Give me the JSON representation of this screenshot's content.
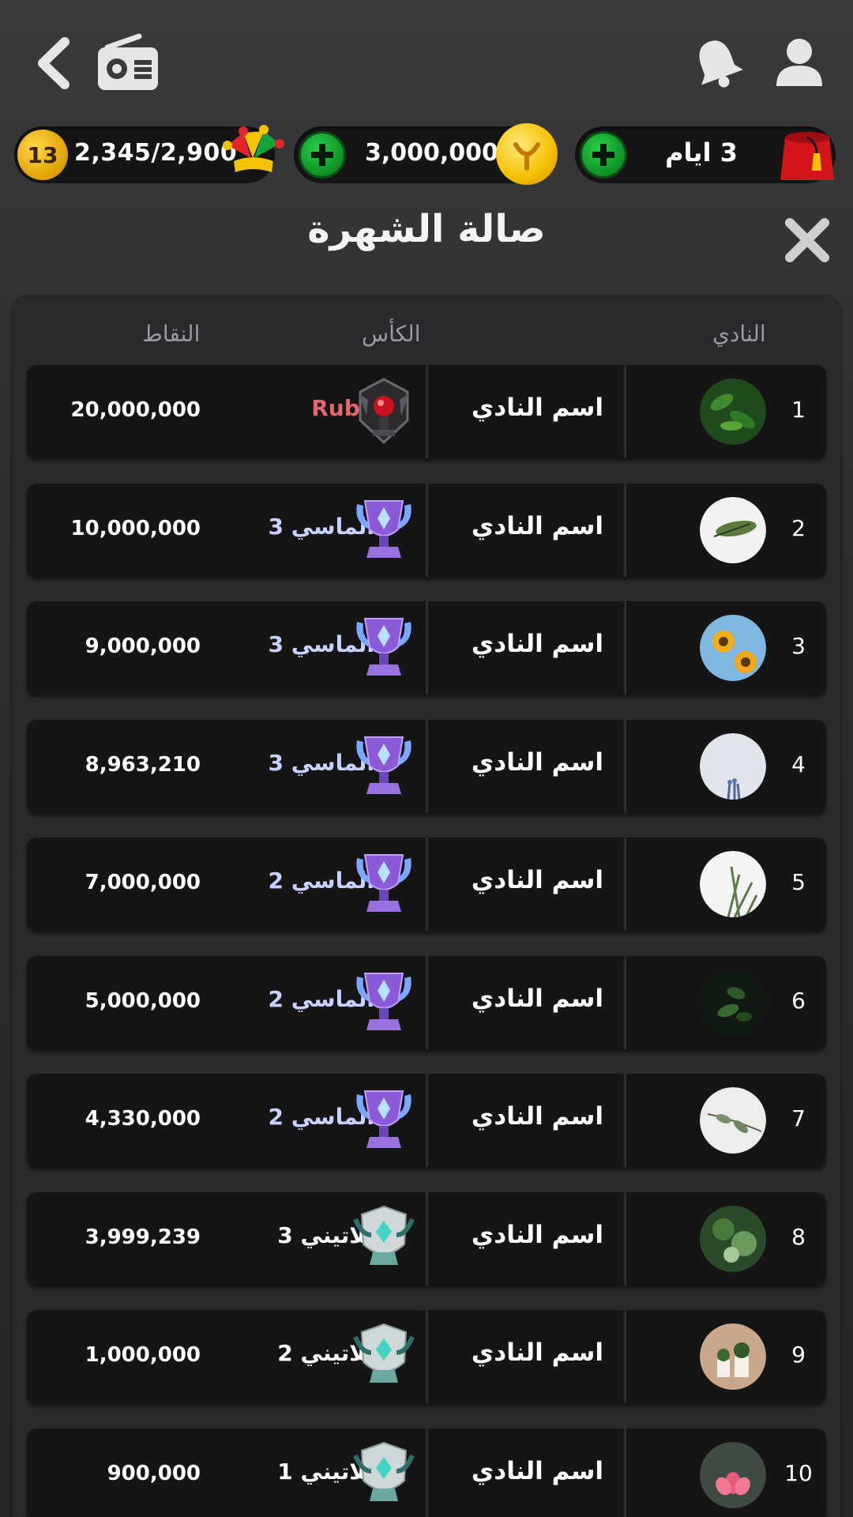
{
  "header": {
    "level": "13",
    "xp": "2,345/2,900",
    "coins": "3,000,000",
    "vip": "3 ايام",
    "title": "صالة الشهرة"
  },
  "table": {
    "col_points": "النقاط",
    "col_cup": "الكأس",
    "col_club": "النادي",
    "rows": [
      {
        "rank": "1",
        "club": "اسم النادي",
        "cup": "Ruby",
        "cup_tier": "ruby",
        "points": "20,000,000",
        "avatar": "green-leaves"
      },
      {
        "rank": "2",
        "club": "اسم النادي",
        "cup": "الماسي 3",
        "cup_tier": "diamond",
        "points": "10,000,000",
        "avatar": "white-leaf"
      },
      {
        "rank": "3",
        "club": "اسم النادي",
        "cup": "الماسي 3",
        "cup_tier": "diamond",
        "points": "9,000,000",
        "avatar": "sunflowers"
      },
      {
        "rank": "4",
        "club": "اسم النادي",
        "cup": "الماسي 3",
        "cup_tier": "diamond",
        "points": "8,963,210",
        "avatar": "lavender"
      },
      {
        "rank": "5",
        "club": "اسم النادي",
        "cup": "الماسي 2",
        "cup_tier": "diamond",
        "points": "7,000,000",
        "avatar": "grass"
      },
      {
        "rank": "6",
        "club": "اسم النادي",
        "cup": "الماسي 2",
        "cup_tier": "diamond",
        "points": "5,000,000",
        "avatar": "dark-leaves"
      },
      {
        "rank": "7",
        "club": "اسم النادي",
        "cup": "الماسي 2",
        "cup_tier": "diamond",
        "points": "4,330,000",
        "avatar": "branch"
      },
      {
        "rank": "8",
        "club": "اسم النادي",
        "cup": "بلاتيني 3",
        "cup_tier": "platinum",
        "points": "3,999,239",
        "avatar": "jungle"
      },
      {
        "rank": "9",
        "club": "اسم النادي",
        "cup": "بلاتيني 2",
        "cup_tier": "platinum",
        "points": "1,000,000",
        "avatar": "pots"
      },
      {
        "rank": "10",
        "club": "اسم النادي",
        "cup": "بلاتيني 1",
        "cup_tier": "platinum",
        "points": "900,000",
        "avatar": "lotus"
      }
    ]
  },
  "colors": {
    "ruby_text": "#e0676a",
    "diamond_text": "#c9d2ff",
    "plus_green": "#1bb03a",
    "gold": "#f5c000"
  }
}
